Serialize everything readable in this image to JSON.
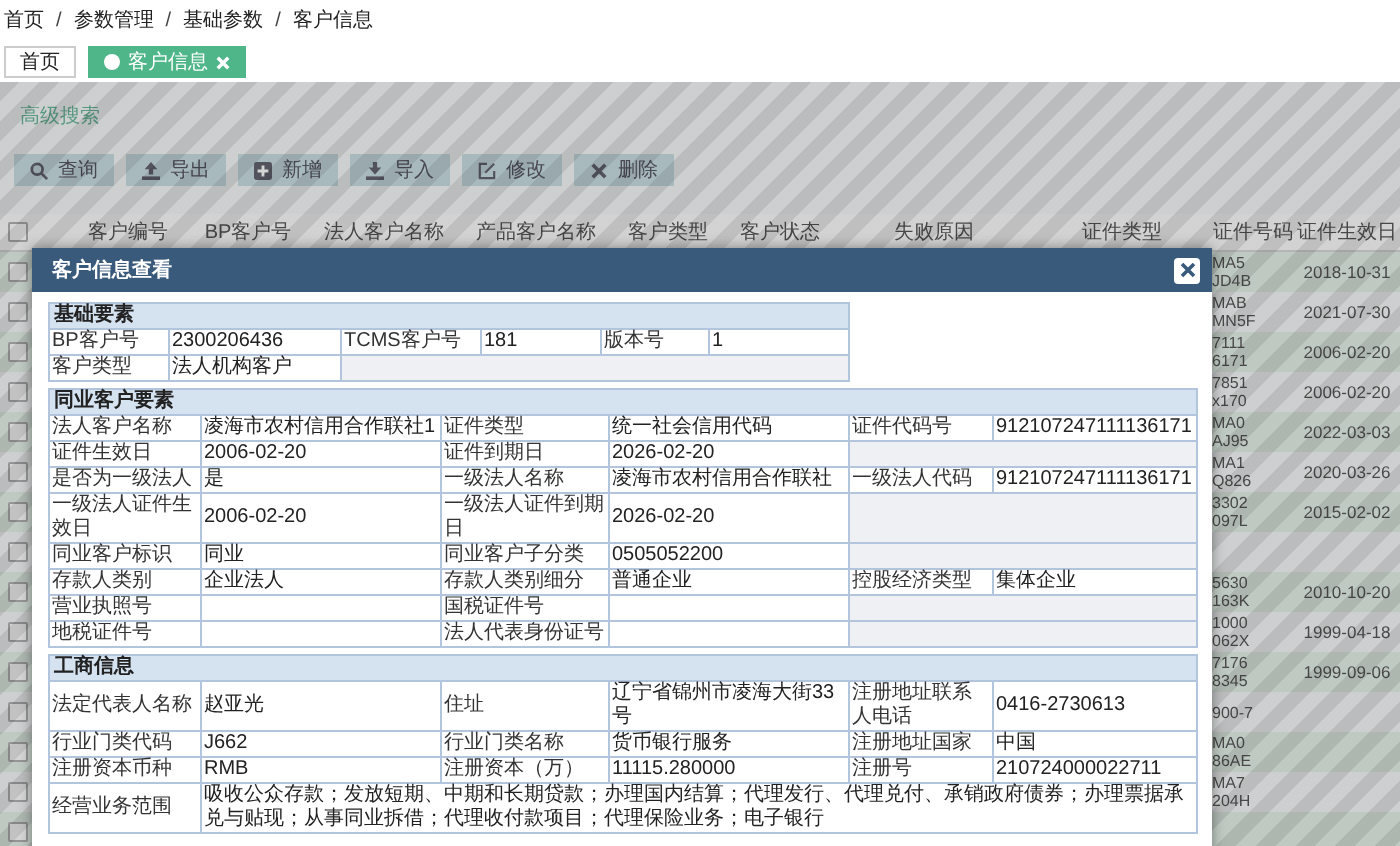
{
  "breadcrumb": {
    "separator": "/",
    "items": [
      "首页",
      "参数管理",
      "基础参数",
      "客户信息"
    ]
  },
  "tabs": [
    {
      "label": "首页",
      "selected": false
    },
    {
      "label": "客户信息",
      "selected": true
    }
  ],
  "advanced_search": "高级搜索",
  "toolbar": [
    "查询",
    "导出",
    "新增",
    "导入",
    "修改",
    "删除"
  ],
  "table": {
    "select_all_checked": false,
    "columns": [
      "客户编号",
      "BP客户号",
      "法人客户名称",
      "产品客户名称",
      "客户类型",
      "客户状态",
      "失败原因",
      "证件类型",
      "证件号码",
      "证件生效日"
    ],
    "rows": [
      {
        "checked": false,
        "id_number_visible": [
          "MA5",
          "JD4B"
        ],
        "valid_from": "2018-10-31"
      },
      {
        "checked": false,
        "id_number_visible": [
          "MAB",
          "MN5F"
        ],
        "valid_from": "2021-07-30"
      },
      {
        "checked": false,
        "id_number_visible": [
          "7111",
          "6171"
        ],
        "valid_from": "2006-02-20"
      },
      {
        "checked": false,
        "id_number_visible": [
          "7851",
          "x170"
        ],
        "valid_from": "2006-02-20"
      },
      {
        "checked": false,
        "id_number_visible": [
          "MA0",
          "AJ95"
        ],
        "valid_from": "2022-03-03"
      },
      {
        "checked": false,
        "id_number_visible": [
          "MA1",
          "Q826"
        ],
        "valid_from": "2020-03-26"
      },
      {
        "checked": false,
        "id_number_visible": [
          "3302",
          "097L"
        ],
        "valid_from": "2015-02-02"
      },
      {
        "checked": false
      },
      {
        "checked": false,
        "id_number_visible": [
          "5630",
          "163K"
        ],
        "valid_from": "2010-10-20"
      },
      {
        "checked": false,
        "id_number_visible": [
          "1000",
          "062X"
        ],
        "valid_from": "1999-04-18"
      },
      {
        "checked": false,
        "id_number_visible": [
          "7176",
          "8345"
        ],
        "valid_from": "1999-09-06"
      },
      {
        "checked": false,
        "id_number_visible": [
          "900-7"
        ]
      },
      {
        "checked": false,
        "id_number_visible": [
          "MA0",
          "86AE"
        ]
      },
      {
        "checked": false,
        "id_number_visible": [
          "MA7",
          "204H"
        ]
      },
      {
        "checked": false
      }
    ]
  },
  "dialog": {
    "title": "客户信息查看",
    "sections": [
      {
        "title": "基础要素",
        "kind": "compact",
        "rows": [
          {
            "kind": "pairs",
            "cells": [
              {
                "label": "BP客户号",
                "value": "2300206436"
              },
              {
                "label": "TCMS客户号",
                "value": "181"
              },
              {
                "label": "版本号",
                "value": "1"
              }
            ]
          },
          {
            "kind": "pairs",
            "cells": [
              {
                "label": "客户类型",
                "value": "法人机构客户"
              }
            ]
          }
        ]
      },
      {
        "title": "同业客户要素",
        "kind": "full",
        "rows": [
          {
            "kind": "pairs",
            "cells": [
              {
                "label": "法人客户名称",
                "value": "凌海市农村信用合作联社1"
              },
              {
                "label": "证件类型",
                "value": "统一社会信用代码"
              },
              {
                "label": "证件代码号",
                "value": "912107247111136171"
              }
            ]
          },
          {
            "kind": "pairs",
            "cells": [
              {
                "label": "证件生效日",
                "value": "2006-02-20"
              },
              {
                "label": "证件到期日",
                "value": "2026-02-20"
              }
            ]
          },
          {
            "kind": "pairs",
            "cells": [
              {
                "label": "是否为一级法人",
                "value": "是"
              },
              {
                "label": "一级法人名称",
                "value": "凌海市农村信用合作联社"
              },
              {
                "label": "一级法人代码",
                "value": "912107247111136171"
              }
            ]
          },
          {
            "kind": "pairs",
            "cells": [
              {
                "label": "一级法人证件生效日",
                "value": "2006-02-20"
              },
              {
                "label": "一级法人证件到期日",
                "value": "2026-02-20"
              }
            ]
          },
          {
            "kind": "pairs",
            "cells": [
              {
                "label": "同业客户标识",
                "value": "同业"
              },
              {
                "label": "同业客户子分类",
                "value": "0505052200"
              }
            ]
          },
          {
            "kind": "pairs",
            "cells": [
              {
                "label": "存款人类别",
                "value": "企业法人"
              },
              {
                "label": "存款人类别细分",
                "value": "普通企业"
              },
              {
                "label": "控股经济类型",
                "value": "集体企业"
              }
            ]
          },
          {
            "kind": "pairs",
            "cells": [
              {
                "label": "营业执照号"
              },
              {
                "label": "国税证件号"
              }
            ]
          },
          {
            "kind": "pairs",
            "cells": [
              {
                "label": "地税证件号"
              },
              {
                "label": "法人代表身份证号"
              }
            ]
          }
        ]
      },
      {
        "title": "工商信息",
        "kind": "full",
        "rows": [
          {
            "kind": "pairs",
            "cells": [
              {
                "label": "法定代表人名称",
                "value": "赵亚光"
              },
              {
                "label": "住址",
                "value": "辽宁省锦州市凌海大街33号"
              },
              {
                "label": "注册地址联系人电话",
                "value": "0416-2730613"
              }
            ]
          },
          {
            "kind": "pairs",
            "cells": [
              {
                "label": "行业门类代码",
                "value": "J662"
              },
              {
                "label": "行业门类名称",
                "value": "货币银行服务"
              },
              {
                "label": "注册地址国家",
                "value": "中国"
              }
            ]
          },
          {
            "kind": "pairs",
            "cells": [
              {
                "label": "注册资本币种",
                "value": "RMB"
              },
              {
                "label": "注册资本（万）",
                "value": "11115.280000"
              },
              {
                "label": "注册号",
                "value": "210724000022711"
              }
            ]
          },
          {
            "kind": "full",
            "cells": [
              {
                "label": "经营业务范围",
                "value": "吸收公众存款；发放短期、中期和长期贷款；办理国内结算；代理发行、代理兑付、承销政府债券；办理票据承兑与贴现；从事同业拆借；代理收付款项目；代理保险业务；电子银行"
              }
            ]
          }
        ]
      }
    ]
  }
}
